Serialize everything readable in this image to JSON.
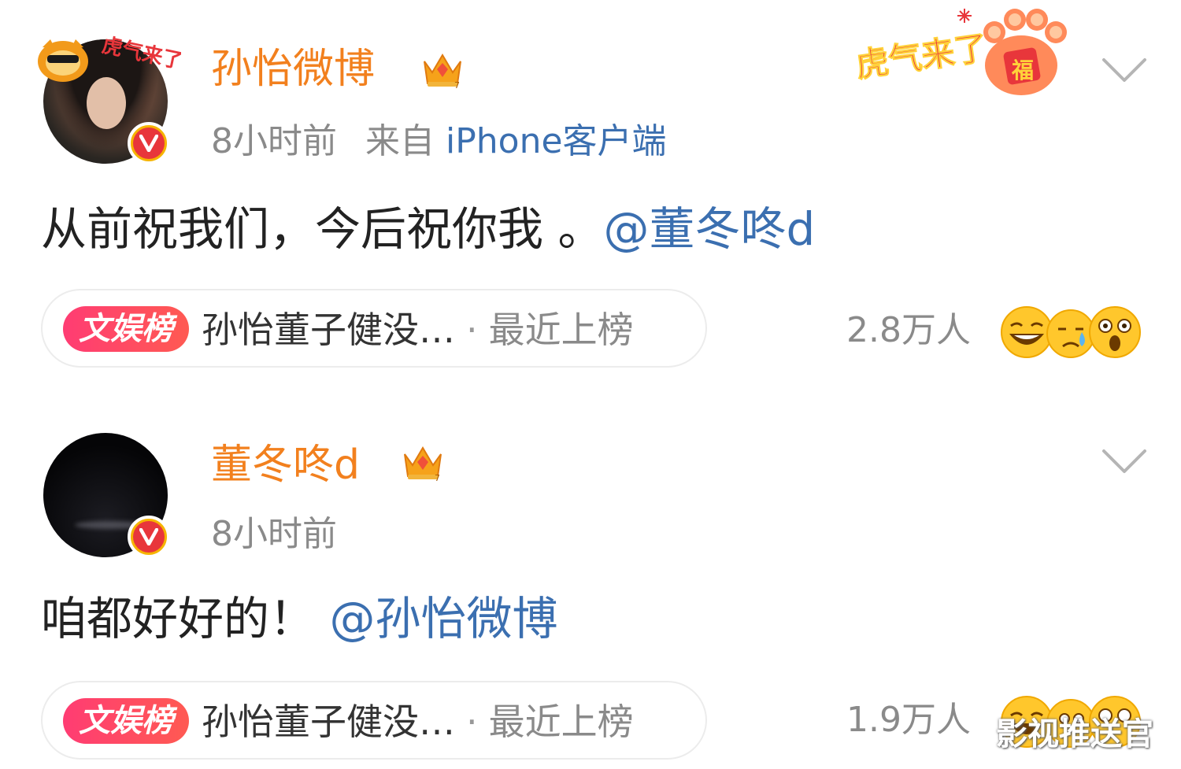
{
  "posts": [
    {
      "name": "孙怡微博",
      "time": "8小时前",
      "source_prefix": "来自",
      "source": "iPhone客户端",
      "text": "从前祝我们，今后祝你我 。",
      "mention": "@董冬咚d",
      "hot_tag": "文娱榜",
      "hot_title": "孙怡董子健没…",
      "hot_dot": "·",
      "hot_sub": "最近上榜",
      "reaction_count": "2.8万人",
      "avatar_frame_text": "虎气来了",
      "sticker_text": "虎气来了",
      "sticker_badge": "福",
      "reaction_icons": [
        "laughing-emoji",
        "crying-emoji",
        "shocked-emoji"
      ]
    },
    {
      "name": "董冬咚d",
      "time": "8小时前",
      "text": "咱都好好的！",
      "mention": "@孙怡微博",
      "hot_tag": "文娱榜",
      "hot_title": "孙怡董子健没…",
      "hot_dot": "·",
      "hot_sub": "最近上榜",
      "reaction_count": "1.9万人",
      "reaction_icons": [
        "laughing-emoji",
        "crying-emoji",
        "shocked-emoji"
      ]
    }
  ],
  "watermark": "影视推送官",
  "colors": {
    "name": "#f2801e",
    "link": "#3b6fb0",
    "meta": "#8a8a8a",
    "tag_start": "#ff3c73",
    "tag_end": "#ff5a52",
    "verified_outer": "#f6b400",
    "verified_inner": "#e8363b"
  }
}
